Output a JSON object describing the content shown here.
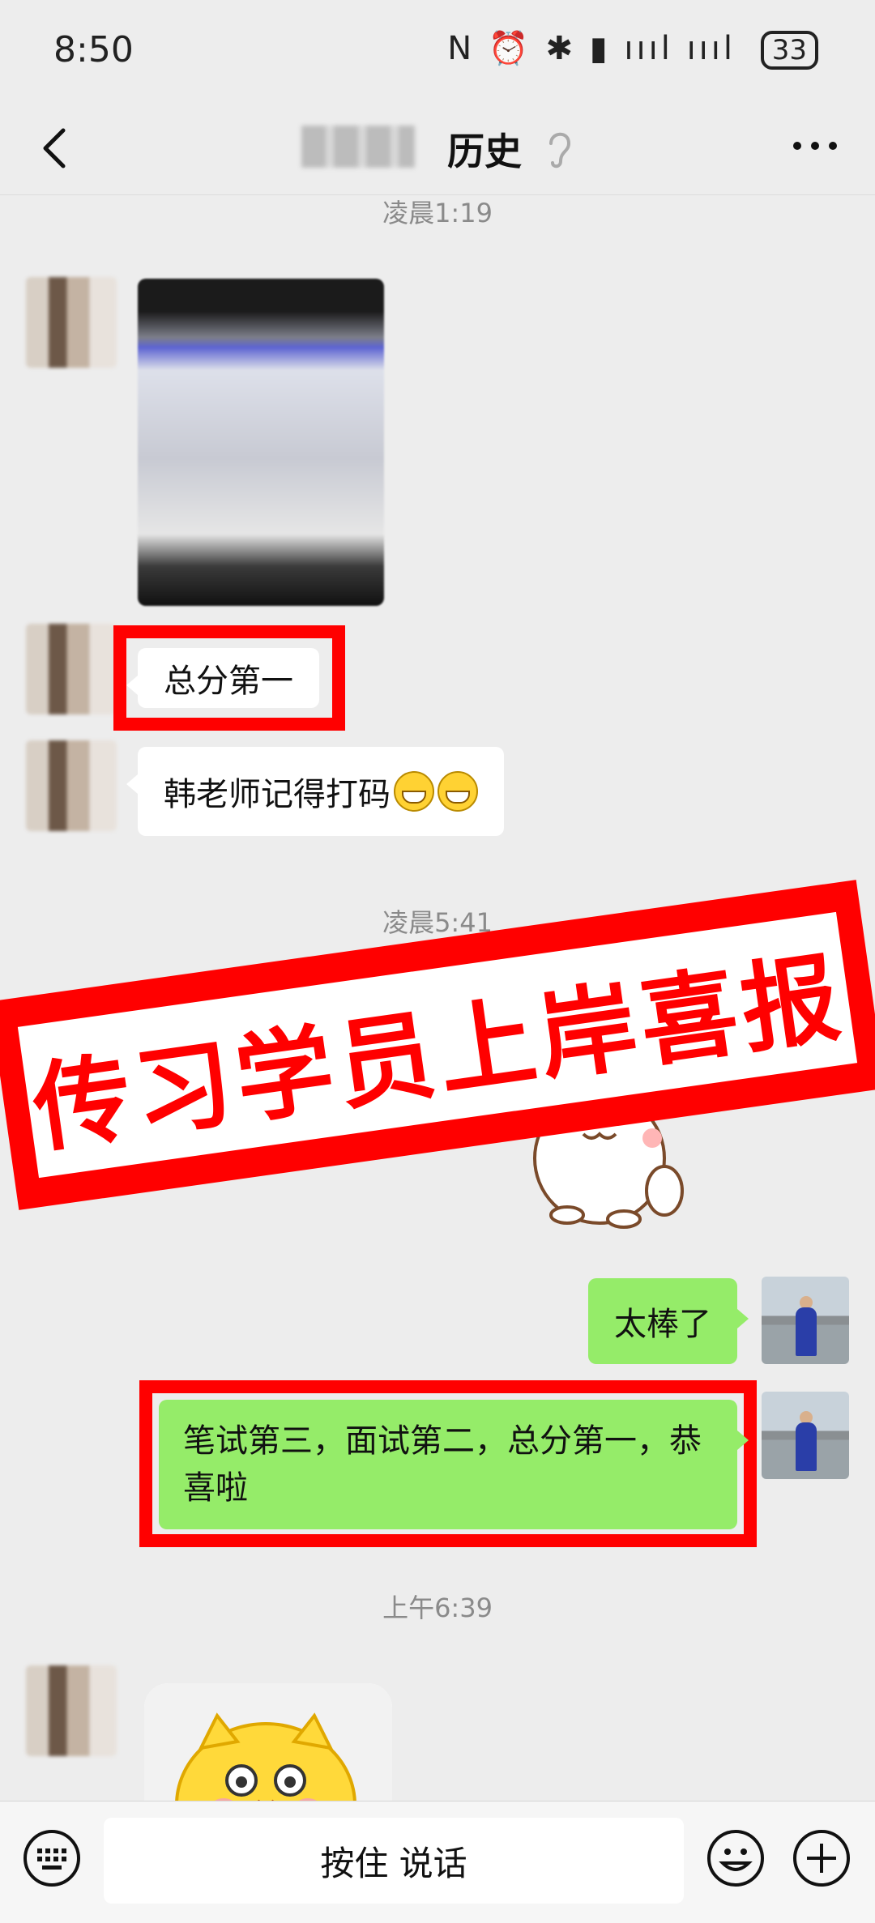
{
  "status_bar": {
    "time": "8:50",
    "icons": "N ⏰ ✱ ▮ ıııl ıııl",
    "battery": "33"
  },
  "header": {
    "title": "历史"
  },
  "messages": {
    "time1": "凌晨1:19",
    "msg_total_first": "总分第一",
    "msg_teacher": "韩老师记得打码",
    "time2": "凌晨5:41",
    "msg_great": "太棒了",
    "msg_congrats": "笔试第三，面试第二，总分第一，恭喜啦",
    "time3": "上午6:39"
  },
  "banner": {
    "text": "传习学员上岸喜报"
  },
  "input_bar": {
    "voice_label": "按住 说话"
  },
  "colors": {
    "accent_red": "#ff0000",
    "bubble_green": "#95ec69",
    "background": "#ededed"
  }
}
